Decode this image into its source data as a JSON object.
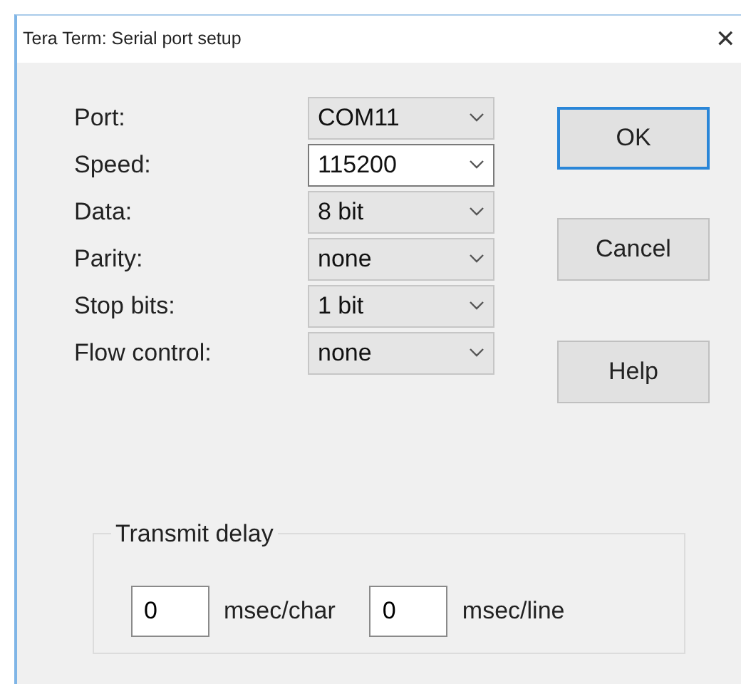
{
  "window": {
    "title": "Tera Term: Serial port setup",
    "close": "✕"
  },
  "fields": [
    {
      "label": "Port:",
      "value": "COM11",
      "kind": "dropdown"
    },
    {
      "label": "Speed:",
      "value": "115200",
      "kind": "editable"
    },
    {
      "label": "Data:",
      "value": "8 bit",
      "kind": "dropdown"
    },
    {
      "label": "Parity:",
      "value": "none",
      "kind": "dropdown"
    },
    {
      "label": "Stop bits:",
      "value": "1 bit",
      "kind": "dropdown"
    },
    {
      "label": "Flow control:",
      "value": "none",
      "kind": "dropdown"
    }
  ],
  "buttons": [
    {
      "label": "OK",
      "default": true
    },
    {
      "label": "Cancel",
      "default": false
    },
    {
      "label": "Help",
      "default": false
    }
  ],
  "transmit_delay": {
    "title": "Transmit delay",
    "inputs": [
      {
        "value": "0",
        "unit": "msec/char"
      },
      {
        "value": "0",
        "unit": "msec/line"
      }
    ]
  }
}
